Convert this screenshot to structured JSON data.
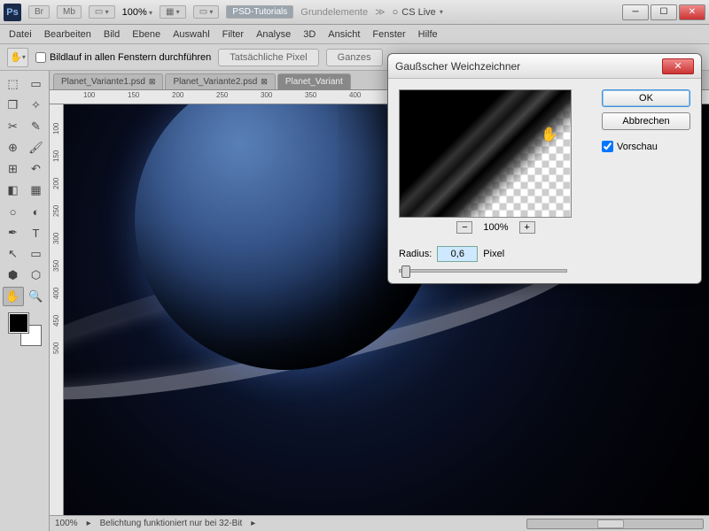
{
  "titlebar": {
    "app_abbr": "Ps",
    "btns": [
      "Br",
      "Mb"
    ],
    "zoom": "100%",
    "psd_tutorials": "PSD-Tutorials",
    "grundelemente": "Grundelemente",
    "cslive": "CS Live"
  },
  "menu": [
    "Datei",
    "Bearbeiten",
    "Bild",
    "Ebene",
    "Auswahl",
    "Filter",
    "Analyse",
    "3D",
    "Ansicht",
    "Fenster",
    "Hilfe"
  ],
  "options": {
    "scroll_all": "Bildlauf in allen Fenstern durchführen",
    "actual": "Tatsächliche Pixel",
    "fit": "Ganzes"
  },
  "tabs": [
    {
      "label": "Planet_Variante1.psd",
      "active": false
    },
    {
      "label": "Planet_Variante2.psd",
      "active": false
    },
    {
      "label": "Planet_Variant",
      "active": true
    }
  ],
  "ruler_h": [
    "100",
    "150",
    "200",
    "250",
    "300",
    "350",
    "400"
  ],
  "ruler_v": [
    "100",
    "150",
    "200",
    "250",
    "300",
    "350",
    "400",
    "450",
    "500"
  ],
  "status": {
    "zoom": "100%",
    "msg": "Belichtung funktioniert nur bei 32-Bit"
  },
  "dialog": {
    "title": "Gaußscher Weichzeichner",
    "ok": "OK",
    "cancel": "Abbrechen",
    "preview": "Vorschau",
    "zoom": "100%",
    "radius_label": "Radius:",
    "radius_value": "0,6",
    "radius_unit": "Pixel"
  }
}
